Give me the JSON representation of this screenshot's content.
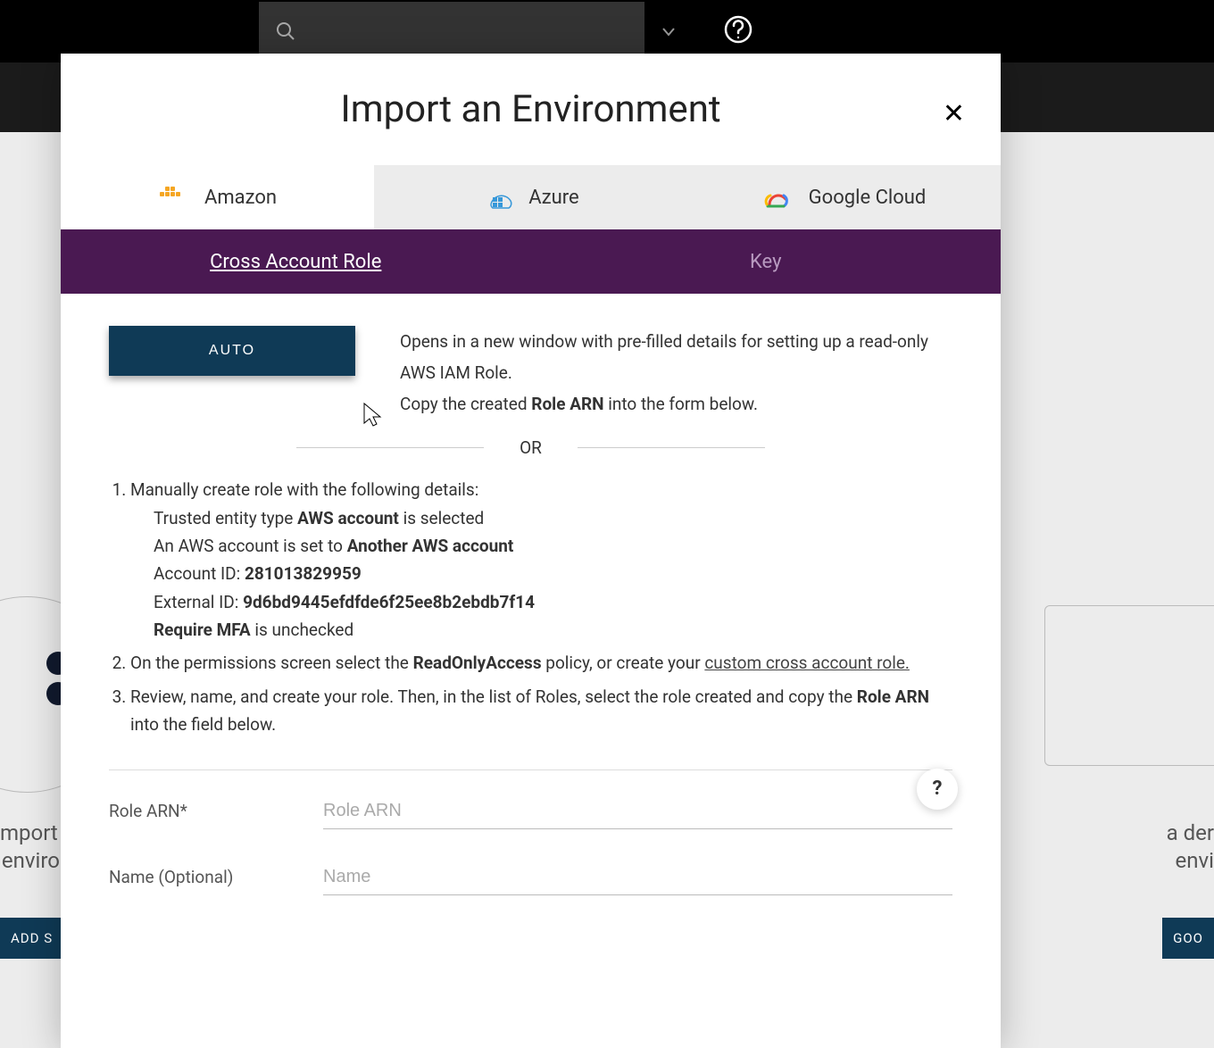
{
  "topbar": {
    "search_placeholder": ""
  },
  "background": {
    "left_text_line1": "mport y",
    "left_text_line2": "environ",
    "left_button": "ADD S",
    "right_text_line1": "a der",
    "right_text_line2": "envi",
    "right_button": "GOO"
  },
  "modal": {
    "title": "Import an Environment",
    "providers": [
      {
        "label": "Amazon",
        "slug": "amazon",
        "active": true
      },
      {
        "label": "Azure",
        "slug": "azure",
        "active": false
      },
      {
        "label": "Google Cloud",
        "slug": "google-cloud",
        "active": false
      }
    ],
    "auth_tabs": [
      {
        "label": "Cross Account Role",
        "slug": "cross-account-role",
        "active": true
      },
      {
        "label": "Key",
        "slug": "key",
        "active": false
      }
    ],
    "auto_button": "AUTO",
    "auto_desc_1": "Opens in a new window with pre-filled details for setting up a read-only AWS IAM Role.",
    "auto_desc_2a": "Copy the created ",
    "auto_desc_2b": "Role ARN",
    "auto_desc_2c": " into the form below.",
    "or_label": "OR",
    "steps": {
      "s1_lead": "Manually create role with the following details:",
      "s1_a_pre": "Trusted entity type ",
      "s1_a_b": "AWS account",
      "s1_a_post": " is selected",
      "s1_b_pre": "An AWS account is set to ",
      "s1_b_b": "Another AWS account",
      "s1_c_pre": "Account ID: ",
      "s1_c_b": "281013829959",
      "s1_d_pre": "External ID: ",
      "s1_d_b": "9d6bd9445efdfde6f25ee8b2ebdb7f14",
      "s1_e_b": "Require MFA",
      "s1_e_post": " is unchecked",
      "s2_pre": "On the permissions screen select the ",
      "s2_b": "ReadOnlyAccess",
      "s2_mid": " policy, or create your ",
      "s2_link": "custom cross account role.",
      "s3_pre": "Review, name, and create your role. Then, in the list of Roles, select the role created and copy the ",
      "s3_b": "Role ARN",
      "s3_post": " into the field below."
    },
    "fields": {
      "role_arn_label": "Role ARN*",
      "role_arn_placeholder": "Role ARN",
      "name_label": "Name (Optional)",
      "name_placeholder": "Name"
    },
    "help_badge": "?"
  }
}
